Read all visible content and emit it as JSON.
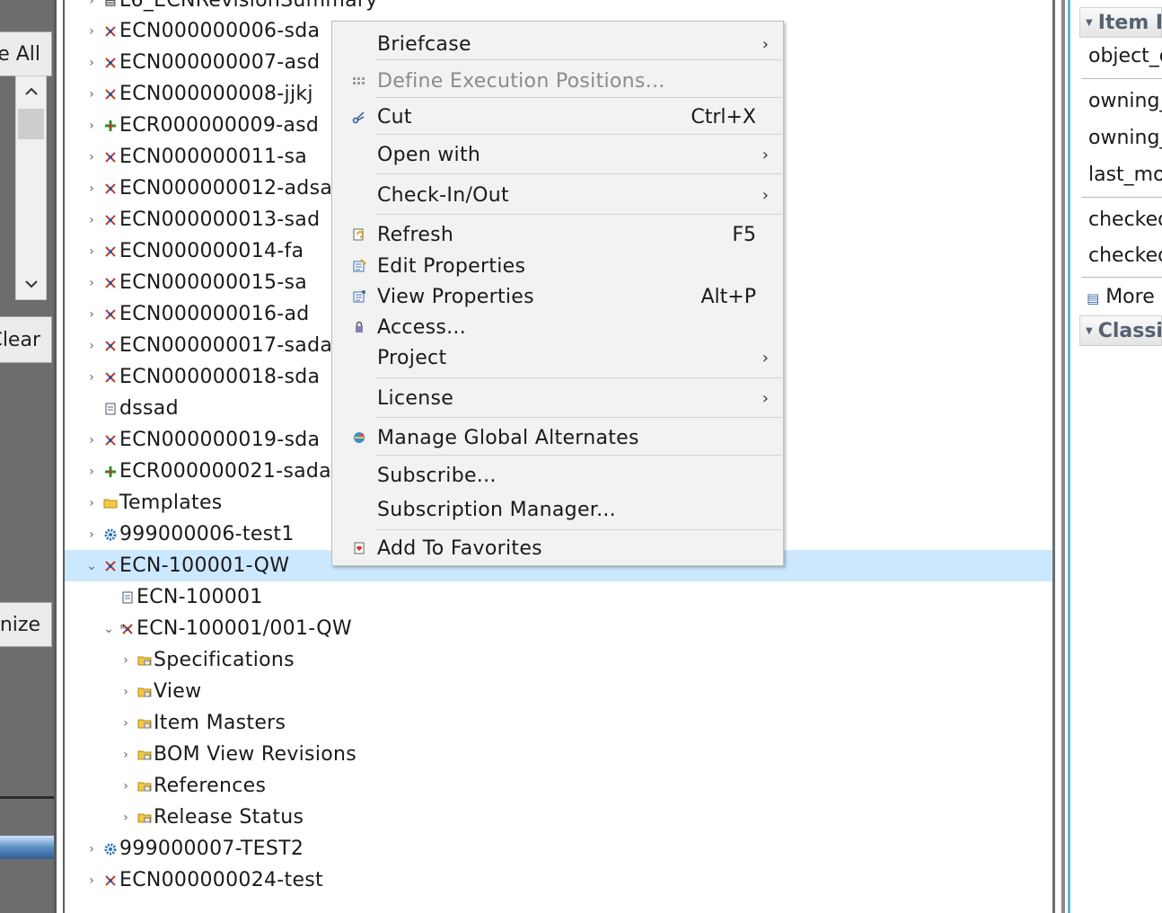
{
  "left_panel": {
    "select_all_label": "e All",
    "clear_label": "Clear",
    "organize_label": "nize"
  },
  "tree": {
    "top_cut_label": "L6_ECNRevisionSummary",
    "rows": [
      {
        "label": "ECN000000006-sda",
        "type": "ecn"
      },
      {
        "label": "ECN000000007-asd",
        "type": "ecn"
      },
      {
        "label": "ECN000000008-jjkj",
        "type": "ecn"
      },
      {
        "label": "ECR000000009-asd",
        "type": "ecr"
      },
      {
        "label": "ECN000000011-sa",
        "type": "ecn"
      },
      {
        "label": "ECN000000012-adsa",
        "type": "ecn"
      },
      {
        "label": "ECN000000013-sad",
        "type": "ecn"
      },
      {
        "label": "ECN000000014-fa",
        "type": "ecn"
      },
      {
        "label": "ECN000000015-sa",
        "type": "ecn"
      },
      {
        "label": "ECN000000016-ad",
        "type": "ecn"
      },
      {
        "label": "ECN000000017-sada",
        "type": "ecn"
      },
      {
        "label": "ECN000000018-sda",
        "type": "ecn"
      },
      {
        "label": "dssad",
        "type": "doc"
      },
      {
        "label": "ECN000000019-sda",
        "type": "ecn"
      },
      {
        "label": "ECR000000021-sada",
        "type": "ecr"
      },
      {
        "label": "Templates",
        "type": "folder"
      },
      {
        "label": "999000006-test1",
        "type": "gear"
      },
      {
        "label": "ECN-100001-QW",
        "type": "ecn"
      },
      {
        "label": "ECN-100001",
        "type": "doc"
      },
      {
        "label": "ECN-100001/001-QW",
        "type": "ecnrev"
      },
      {
        "label": "Specifications",
        "type": "pseudo"
      },
      {
        "label": "View",
        "type": "pseudo"
      },
      {
        "label": "Item Masters",
        "type": "pseudo"
      },
      {
        "label": "BOM View Revisions",
        "type": "pseudo"
      },
      {
        "label": "References",
        "type": "pseudo"
      },
      {
        "label": "Release Status",
        "type": "pseudo"
      },
      {
        "label": "999000007-TEST2",
        "type": "gear"
      },
      {
        "label": "ECN000000024-test",
        "type": "ecn"
      }
    ]
  },
  "context_menu": {
    "items": [
      {
        "label": "Briefcase",
        "shortcut": "",
        "submenu": true
      },
      {
        "label": "Define Execution Positions...",
        "shortcut": "",
        "disabled": true
      },
      {
        "label": "Cut",
        "shortcut": "Ctrl+X"
      },
      {
        "label": "Open with",
        "shortcut": "",
        "submenu": true
      },
      {
        "label": "Check-In/Out",
        "shortcut": "",
        "submenu": true
      },
      {
        "label": "Refresh",
        "shortcut": "F5"
      },
      {
        "label": "Edit Properties",
        "shortcut": ""
      },
      {
        "label": "View Properties",
        "shortcut": "Alt+P"
      },
      {
        "label": "Access...",
        "shortcut": ""
      },
      {
        "label": "Project",
        "shortcut": "",
        "submenu": true
      },
      {
        "label": "License",
        "shortcut": "",
        "submenu": true
      },
      {
        "label": "Manage Global Alternates",
        "shortcut": ""
      },
      {
        "label": "Subscribe...",
        "shortcut": ""
      },
      {
        "label": "Subscription Manager...",
        "shortcut": ""
      },
      {
        "label": "Add To Favorites",
        "shortcut": ""
      }
    ]
  },
  "right_panel": {
    "section1_title": "Item P",
    "fields": [
      "object_d",
      "owning_",
      "owning_",
      "last_mo",
      "checked",
      "checked"
    ],
    "more_label": "More",
    "section2_title": "Classif"
  },
  "colors": {
    "selection": "#cce8ff",
    "menu_bg": "#f2f2f2",
    "left_panel": "#6d6d6d"
  }
}
